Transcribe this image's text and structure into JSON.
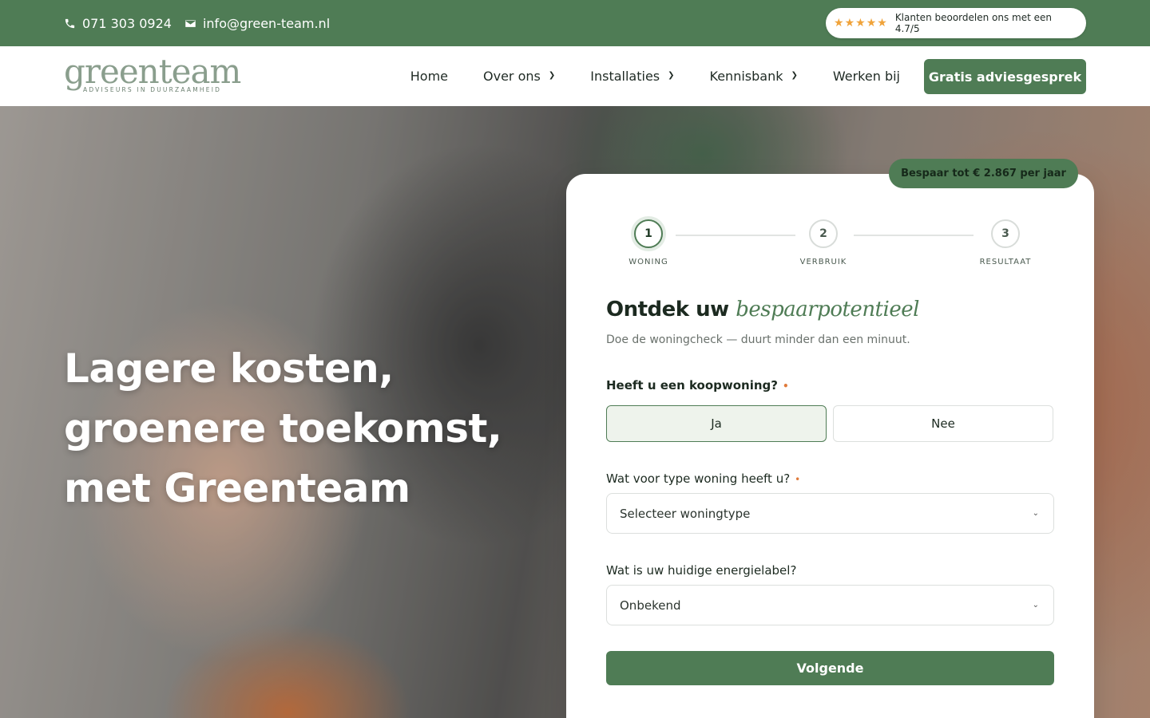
{
  "topbar": {
    "phone": "071 303 0924",
    "email": "info@green-team.nl",
    "rating_text": "Klanten beoordelen ons met een 4.7/5",
    "stars": 5
  },
  "nav": {
    "logo_word": "greenteam",
    "logo_tagline": "ADVISEURS IN DUURZAAMHEID",
    "items": [
      {
        "label": "Home",
        "dropdown": false
      },
      {
        "label": "Over ons",
        "dropdown": true
      },
      {
        "label": "Installaties",
        "dropdown": true
      },
      {
        "label": "Kennisbank",
        "dropdown": true
      },
      {
        "label": "Werken bij",
        "dropdown": false
      }
    ],
    "cta": "Gratis adviesgesprek"
  },
  "hero": {
    "line1": "Lagere kosten,",
    "line2": "groenere toekomst,",
    "line3": "met Greenteam"
  },
  "form": {
    "badge": "Bespaar tot € 2.867 per jaar",
    "steps": [
      {
        "num": "1",
        "label": "WONING"
      },
      {
        "num": "2",
        "label": "VERBRUIK"
      },
      {
        "num": "3",
        "label": "RESULTAAT"
      }
    ],
    "active_step": 1,
    "title_plain": "Ontdek uw",
    "title_accent": "bespaarpotentieel",
    "subtitle": "Doe de woningcheck — duurt minder dan een minuut.",
    "q1": "Heeft u een koopwoning?",
    "q1_yes": "Ja",
    "q1_no": "Nee",
    "q1_selected": "Ja",
    "q2": "Wat voor type woning heeft u?",
    "q2_value": "Selecteer woningtype",
    "q3": "Wat is uw huidige energielabel?",
    "q3_value": "Onbekend",
    "required_mark": "•",
    "next": "Volgende"
  },
  "colors": {
    "brand_green": "#4f7c55",
    "accent_orange": "#e07a3a",
    "star": "#f0a33a"
  }
}
